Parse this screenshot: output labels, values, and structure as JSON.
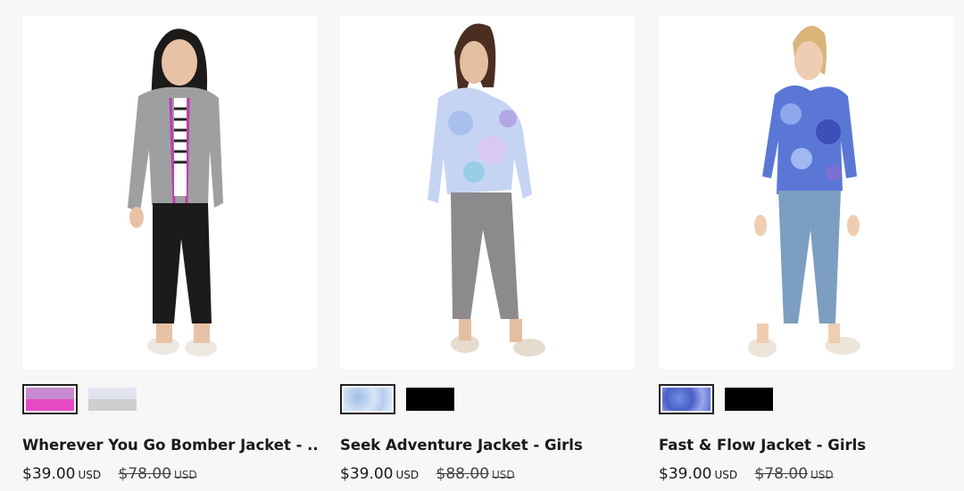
{
  "products": [
    {
      "name": "Wherever You Go Bomber Jacket - ...",
      "price": "$39.00",
      "price_currency": "USD",
      "original_price": "$78.00",
      "original_currency": "USD",
      "swatches": [
        {
          "label": "pink-heather-and-magenta",
          "selected": true
        },
        {
          "label": "light-print-and-grey",
          "selected": false
        }
      ]
    },
    {
      "name": "Seek Adventure Jacket - Girls",
      "price": "$39.00",
      "price_currency": "USD",
      "original_price": "$88.00",
      "original_currency": "USD",
      "swatches": [
        {
          "label": "blue-watercolor-print",
          "selected": true
        },
        {
          "label": "black",
          "selected": false
        }
      ]
    },
    {
      "name": "Fast & Flow Jacket - Girls",
      "price": "$39.00",
      "price_currency": "USD",
      "original_price": "$78.00",
      "original_currency": "USD",
      "swatches": [
        {
          "label": "blue-purple-print",
          "selected": true
        },
        {
          "label": "black",
          "selected": false
        }
      ]
    }
  ],
  "colors": {
    "page_background": "#f8f7f7",
    "text": "#1a1a1a",
    "selected_border": "#222222"
  }
}
